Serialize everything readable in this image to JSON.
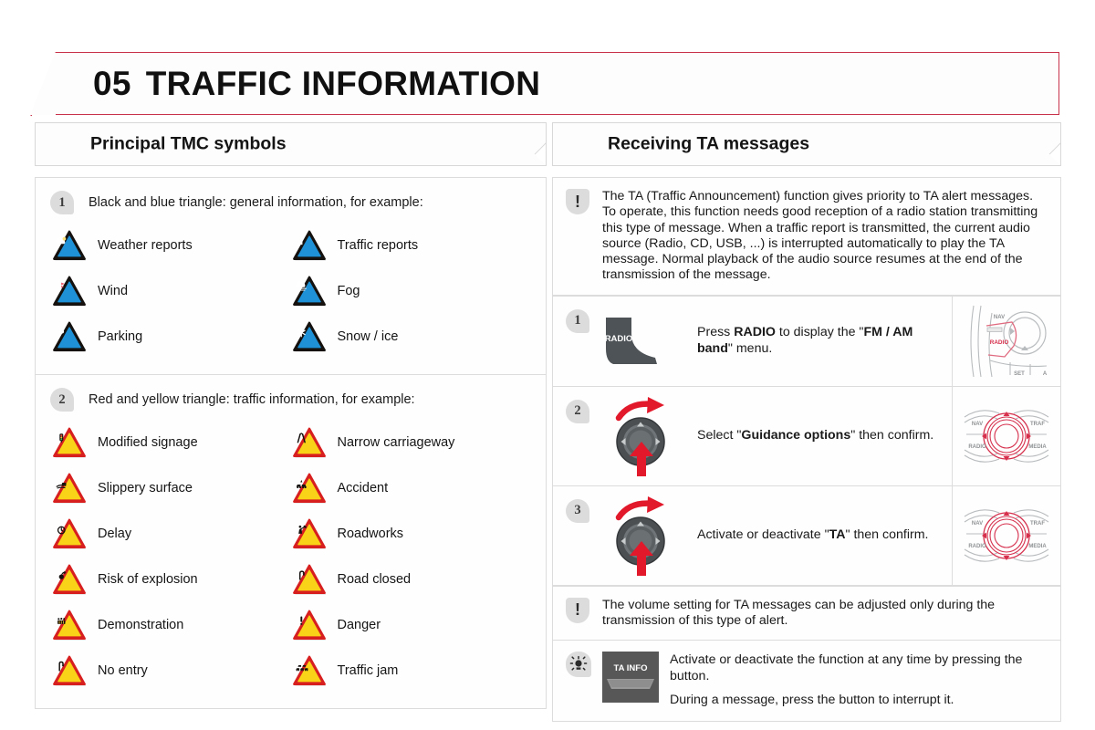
{
  "header": {
    "chapter_number": "05",
    "chapter_title": "TRAFFIC INFORMATION",
    "accent_color": "#c8324b"
  },
  "left_column": {
    "section_title": "Principal TMC symbols",
    "groups": [
      {
        "badge": "1",
        "intro": "Black and blue triangle: general information, for example:",
        "symbol_style": "blue",
        "symbols": [
          {
            "icon": "weather-reports-icon",
            "label": "Weather reports"
          },
          {
            "icon": "traffic-reports-icon",
            "label": "Traffic reports"
          },
          {
            "icon": "wind-icon",
            "label": "Wind"
          },
          {
            "icon": "fog-icon",
            "label": "Fog"
          },
          {
            "icon": "parking-icon",
            "label": "Parking"
          },
          {
            "icon": "snow-ice-icon",
            "label": "Snow / ice"
          }
        ]
      },
      {
        "badge": "2",
        "intro": "Red and yellow triangle: traffic information, for example:",
        "symbol_style": "warning",
        "symbols": [
          {
            "icon": "modified-signage-icon",
            "label": "Modified signage"
          },
          {
            "icon": "narrow-carriageway-icon",
            "label": "Narrow carriageway"
          },
          {
            "icon": "slippery-surface-icon",
            "label": "Slippery surface"
          },
          {
            "icon": "accident-icon",
            "label": "Accident"
          },
          {
            "icon": "delay-icon",
            "label": "Delay"
          },
          {
            "icon": "roadworks-icon",
            "label": "Roadworks"
          },
          {
            "icon": "risk-of-explosion-icon",
            "label": "Risk of explosion"
          },
          {
            "icon": "road-closed-icon",
            "label": "Road closed"
          },
          {
            "icon": "demonstration-icon",
            "label": "Demonstration"
          },
          {
            "icon": "danger-icon",
            "label": "Danger"
          },
          {
            "icon": "no-entry-icon",
            "label": "No entry"
          },
          {
            "icon": "traffic-jam-icon",
            "label": "Traffic jam"
          }
        ]
      }
    ]
  },
  "right_column": {
    "section_title": "Receiving TA messages",
    "intro_note": "The TA (Traffic Announcement) function gives priority to TA alert messages. To operate, this function needs good reception of a radio station transmitting this type of message. When a traffic report is transmitted, the current audio source (Radio, CD, USB, ...) is interrupted automatically to play the TA message. Normal playback of the audio source resumes at the end of the transmission of the message.",
    "steps": [
      {
        "badge": "1",
        "art": "radio-button-art",
        "button_label": "RADIO",
        "text_parts": [
          {
            "t": "Press ",
            "b": false
          },
          {
            "t": "RADIO",
            "b": true
          },
          {
            "t": " to display the \"",
            "b": false
          },
          {
            "t": "FM / AM band",
            "b": true
          },
          {
            "t": "\" menu.",
            "b": false
          }
        ],
        "thumb": "dashboard-radio-key-thumb",
        "thumb_labels": [
          "NAV",
          "RADIO",
          "SET"
        ]
      },
      {
        "badge": "2",
        "art": "rotary-dial-art",
        "text_parts": [
          {
            "t": "Select \"",
            "b": false
          },
          {
            "t": "Guidance options",
            "b": true
          },
          {
            "t": "\" then confirm.",
            "b": false
          }
        ],
        "thumb": "dashboard-dial-thumb",
        "thumb_labels": [
          "NAV",
          "TRAF",
          "RADIO",
          "MEDIA"
        ]
      },
      {
        "badge": "3",
        "art": "rotary-dial-art",
        "text_parts": [
          {
            "t": "Activate or deactivate \"",
            "b": false
          },
          {
            "t": "TA",
            "b": true
          },
          {
            "t": "\" then confirm.",
            "b": false
          }
        ],
        "thumb": "dashboard-dial-thumb",
        "thumb_labels": [
          "NAV",
          "TRAF",
          "RADIO",
          "MEDIA"
        ]
      }
    ],
    "volume_note": "The volume setting for TA messages can be adjusted only during the transmission of this type of alert.",
    "tip": {
      "button_label": "TA INFO",
      "line1": "Activate or deactivate the function at any time by pressing the button.",
      "line2": "During a message, press the button to interrupt it."
    }
  }
}
